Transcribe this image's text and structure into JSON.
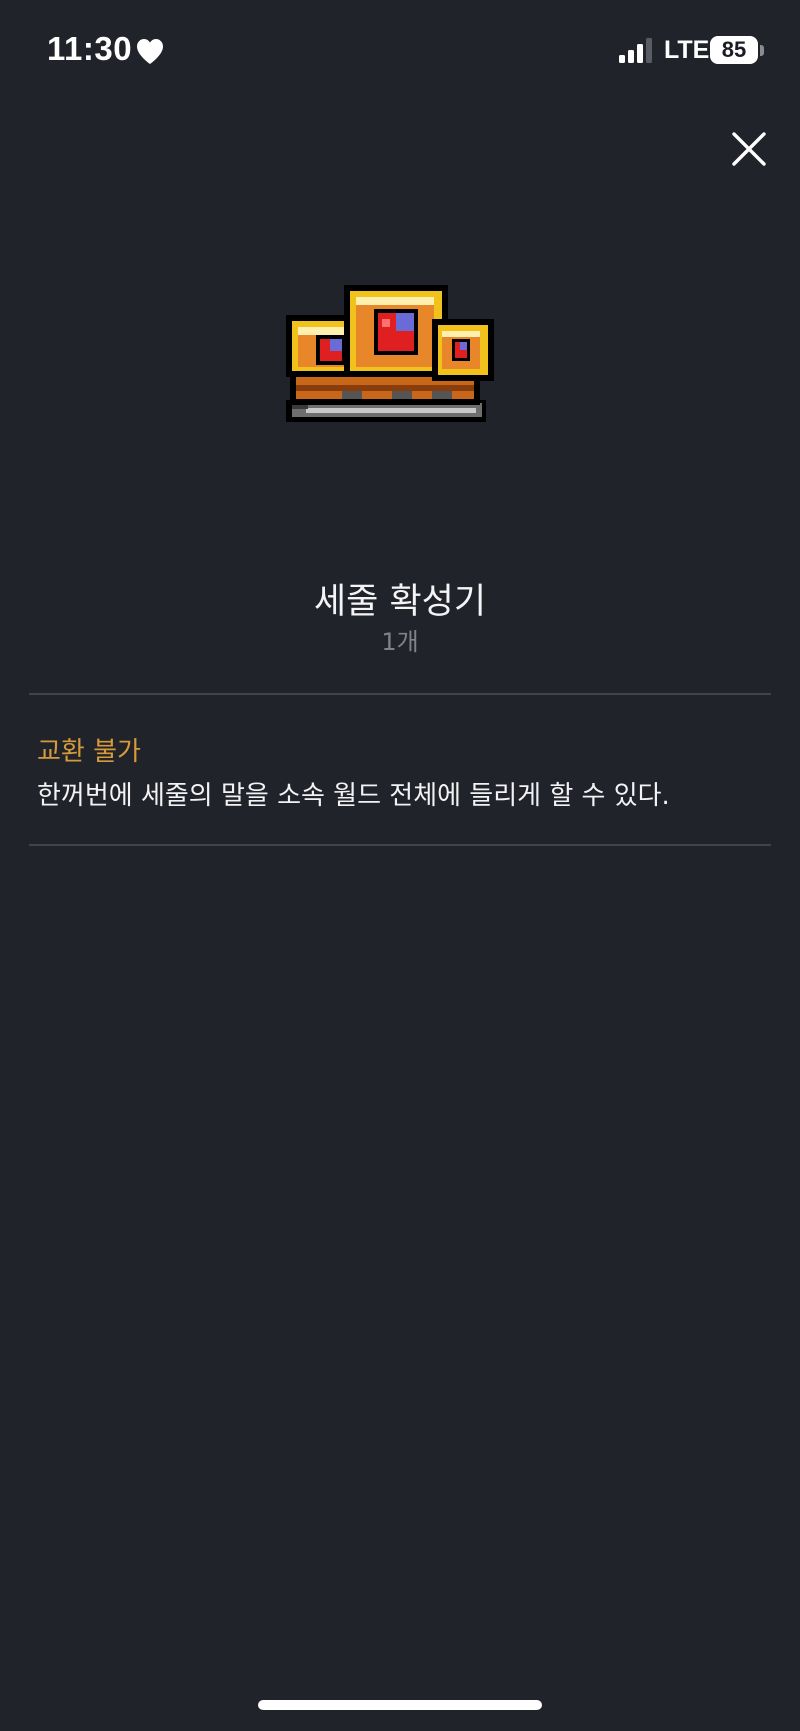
{
  "status_bar": {
    "time": "11:30",
    "network": "LTE",
    "battery": "85"
  },
  "item": {
    "name": "세줄 확성기",
    "count": "1개",
    "trade_status": "교환 불가",
    "description": "한꺼번에 세줄의 말을 소속 월드 전체에 들리게 할 수 있다."
  },
  "colors": {
    "background": "#21232b",
    "trade_status": "#d59a3a",
    "muted": "#7f828b"
  },
  "icons": {
    "close": "close-icon",
    "heart": "heart-icon",
    "signal": "signal-icon"
  }
}
